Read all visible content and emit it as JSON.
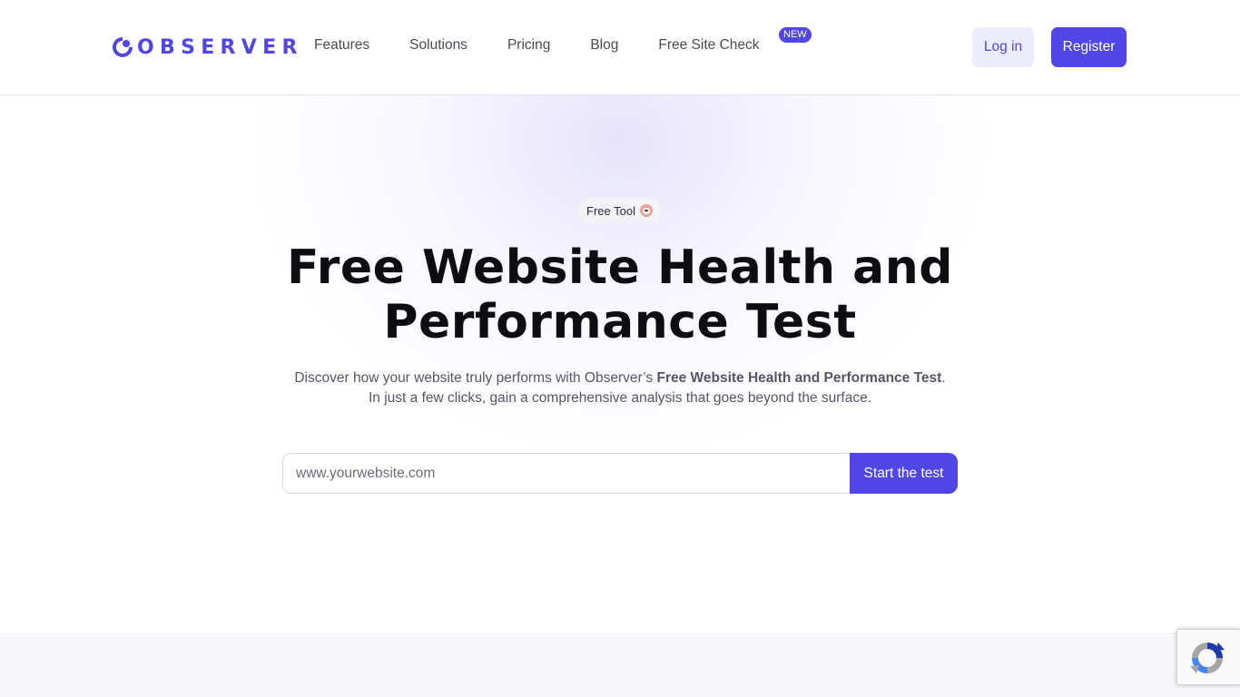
{
  "brand": {
    "name": "OBSERVER",
    "color": "#4f46e5"
  },
  "nav": {
    "items": [
      {
        "label": "Features"
      },
      {
        "label": "Solutions"
      },
      {
        "label": "Pricing"
      },
      {
        "label": "Blog"
      },
      {
        "label": "Free Site Check"
      }
    ],
    "new_badge": "NEW"
  },
  "auth": {
    "login_label": "Log in",
    "register_label": "Register"
  },
  "hero": {
    "pill_label": "Free Tool",
    "pill_icon": "dog-face-emoji",
    "title": "Free Website Health and Performance Test",
    "subtitle_before": "Discover how your website truly performs with Observer’s ",
    "subtitle_bold": "Free Website Health and Performance Test",
    "subtitle_after": ".",
    "subtitle_line2": "In just a few clicks, gain a comprehensive analysis that goes beyond the surface."
  },
  "search": {
    "placeholder": "www.yourwebsite.com",
    "value": "",
    "button_label": "Start the test"
  },
  "recaptcha": {
    "icon": "recaptcha-icon"
  }
}
